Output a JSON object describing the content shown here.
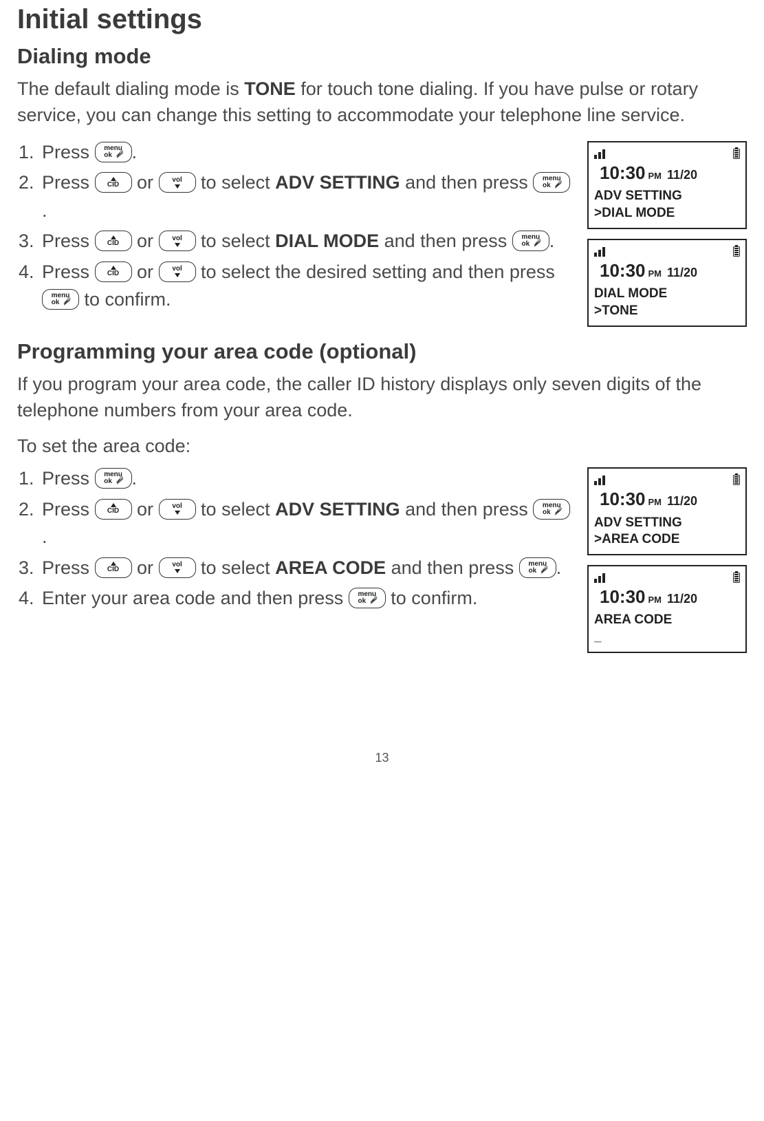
{
  "heading": "Initial settings",
  "section1": {
    "title": "Dialing mode",
    "intro_pre": "The default dialing mode is ",
    "intro_bold": "TONE",
    "intro_post": " for touch tone dialing. If you have pulse or rotary service, you can change this setting to accommodate your telephone line service.",
    "steps": {
      "s1": {
        "num": "1.",
        "t1": "Press ",
        "t2": "."
      },
      "s2": {
        "num": "2.",
        "t1": "Press ",
        "or": " or ",
        "t2": " to select ",
        "sel": "ADV SETTING",
        "t3": " and then press ",
        "t4": "."
      },
      "s3": {
        "num": "3.",
        "t1": "Press ",
        "or": " or ",
        "t2": " to select ",
        "sel": "DIAL MODE",
        "t3": " and then press ",
        "t4": "."
      },
      "s4": {
        "num": "4.",
        "t1": "Press ",
        "or": " or ",
        "t2": " to select the desired setting and then press ",
        "t3": " to confirm."
      }
    },
    "screens": {
      "a": {
        "time": "10:30",
        "ampm": "PM",
        "date": "11/20",
        "l1": "ADV SETTING",
        "l2": ">DIAL MODE"
      },
      "b": {
        "time": "10:30",
        "ampm": "PM",
        "date": "11/20",
        "l1": "DIAL MODE",
        "l2": ">TONE"
      }
    }
  },
  "section2": {
    "title": "Programming your area code (optional)",
    "intro": "If you program your area code, the caller ID history displays only seven digits of the telephone numbers from your area code.",
    "lead": "To set the area code:",
    "steps": {
      "s1": {
        "num": "1.",
        "t1": "Press ",
        "t2": "."
      },
      "s2": {
        "num": "2.",
        "t1": "Press ",
        "or": " or ",
        "t2": " to select ",
        "sel": "ADV SETTING",
        "t3": " and then press ",
        "t4": "."
      },
      "s3": {
        "num": "3.",
        "t1": "Press ",
        "or": " or ",
        "t2": " to select ",
        "sel": "AREA CODE",
        "t3": " and then press ",
        "t4": "."
      },
      "s4": {
        "num": "4.",
        "t1": "Enter your area code and then press ",
        "t2": " to confirm."
      }
    },
    "screens": {
      "a": {
        "time": "10:30",
        "ampm": "PM",
        "date": "11/20",
        "l1": "ADV SETTING",
        "l2": ">AREA CODE"
      },
      "b": {
        "time": "10:30",
        "ampm": "PM",
        "date": "11/20",
        "l1": "AREA CODE",
        "l2": "_"
      }
    }
  },
  "keys": {
    "menu_top": "menu",
    "menu_bot": "ok",
    "cid": "CID",
    "vol": "vol"
  },
  "page_number": "13"
}
